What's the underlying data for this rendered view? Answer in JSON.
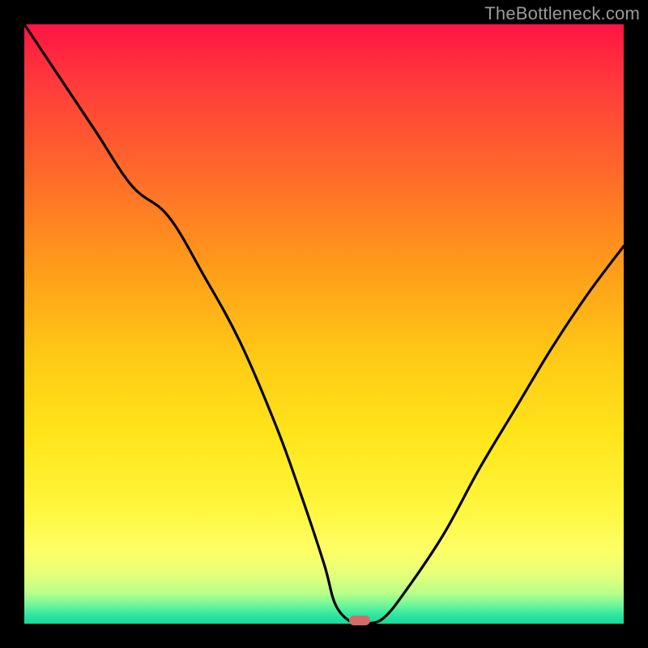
{
  "watermark": "TheBottleneck.com",
  "chart_data": {
    "type": "line",
    "title": "",
    "xlabel": "",
    "ylabel": "",
    "xlim": [
      0,
      100
    ],
    "ylim": [
      0,
      100
    ],
    "grid": false,
    "series": [
      {
        "name": "bottleneck-curve",
        "x": [
          0,
          6,
          12,
          18,
          24,
          30,
          36,
          42,
          46,
          50,
          52,
          55,
          57,
          60,
          64,
          70,
          76,
          82,
          88,
          94,
          100
        ],
        "values": [
          100,
          91,
          82,
          73,
          68,
          58,
          47,
          33,
          22,
          10,
          3,
          0,
          0,
          1,
          6,
          15,
          26,
          36,
          46,
          55,
          63
        ]
      }
    ],
    "marker": {
      "x": 56,
      "y": 0.5,
      "color": "#d46a6a"
    },
    "background_gradient": [
      "#ff1444",
      "#ffe41a",
      "#17d99a"
    ]
  }
}
